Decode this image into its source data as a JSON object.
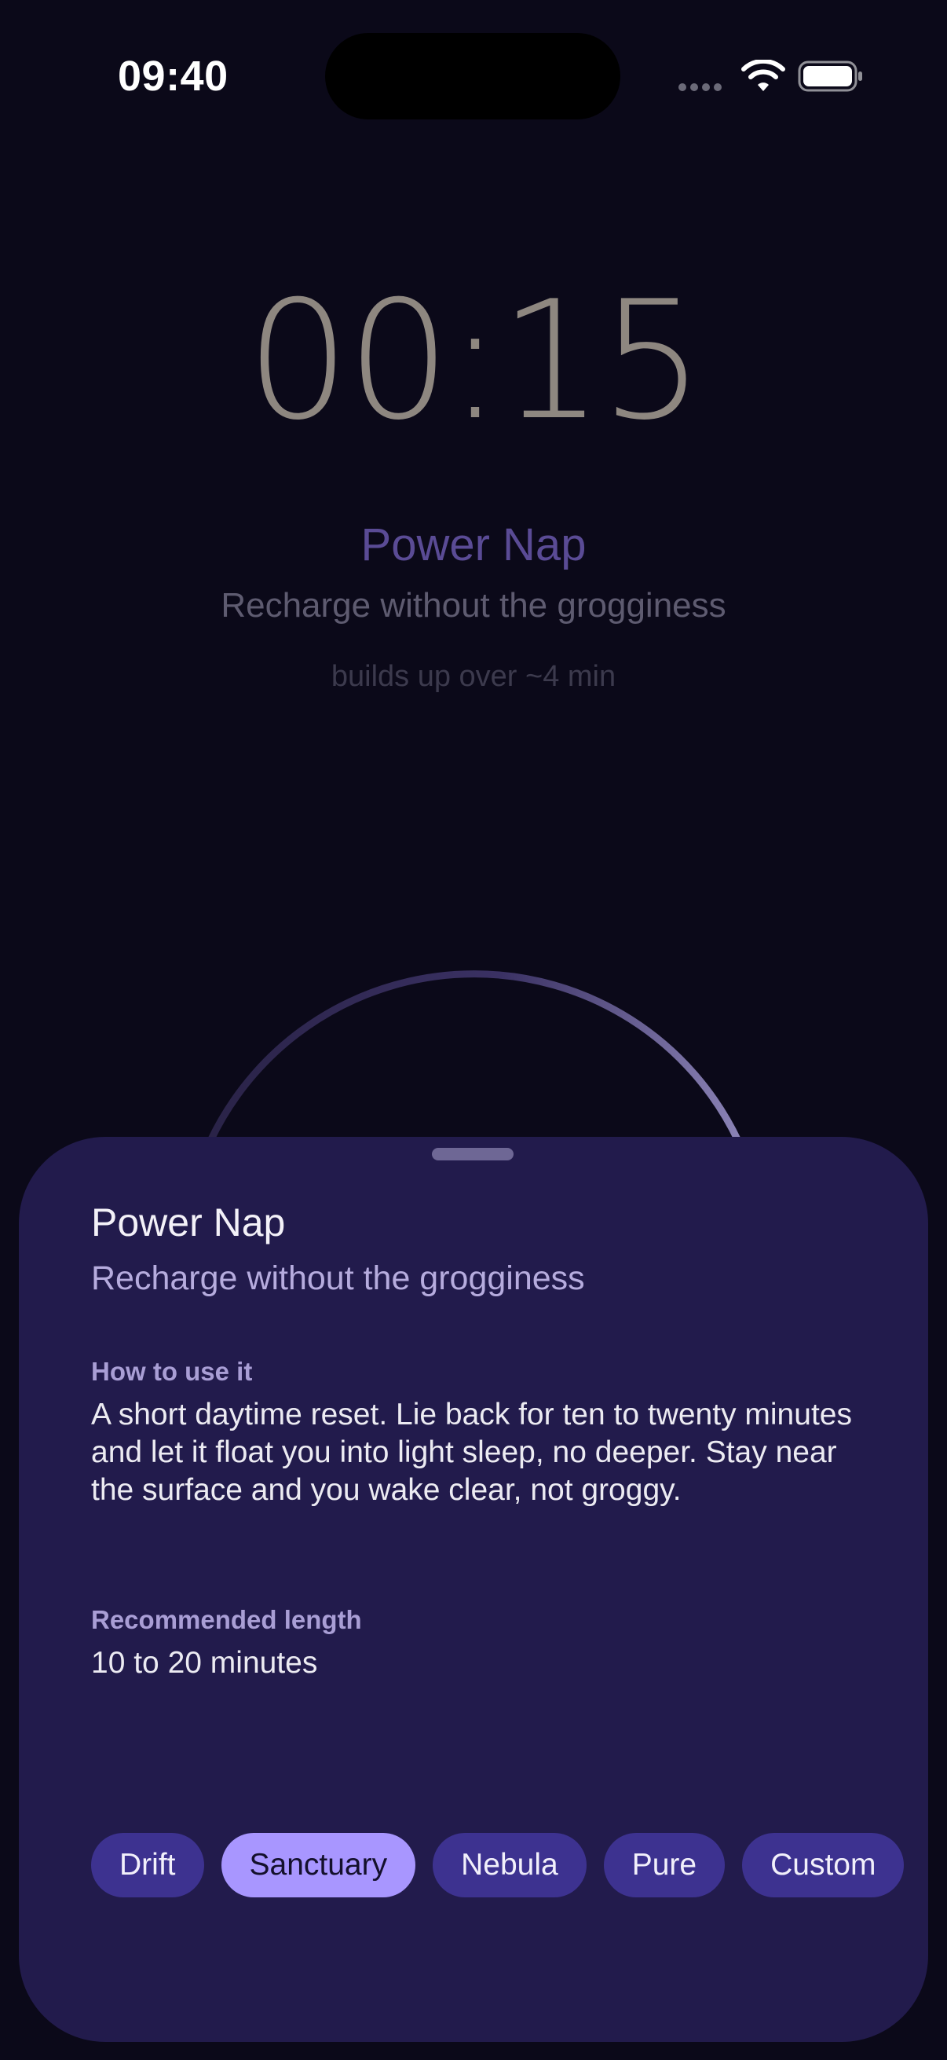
{
  "status_bar": {
    "time": "09:40"
  },
  "timer": {
    "display": "00:15"
  },
  "mode": {
    "title": "Power Nap",
    "subtitle": "Recharge without the grogginess",
    "buildup": "builds up over ~4 min"
  },
  "sheet": {
    "title": "Power Nap",
    "subtitle": "Recharge without the grogginess",
    "how_label": "How to use it",
    "how_body": "A short daytime reset. Lie back for ten to twenty minutes and let it float you into light sleep, no deeper. Stay near the surface and you wake clear, not groggy.",
    "length_label": "Recommended length",
    "length_value": "10 to 20 minutes",
    "chips": [
      {
        "label": "Drift",
        "selected": false
      },
      {
        "label": "Sanctuary",
        "selected": true
      },
      {
        "label": "Nebula",
        "selected": false
      },
      {
        "label": "Pure",
        "selected": false
      },
      {
        "label": "Custom",
        "selected": false
      }
    ]
  },
  "colors": {
    "background": "#0b0919",
    "sheet": "#221b4c",
    "accent": "#a896ff",
    "chip": "#3d3290"
  }
}
